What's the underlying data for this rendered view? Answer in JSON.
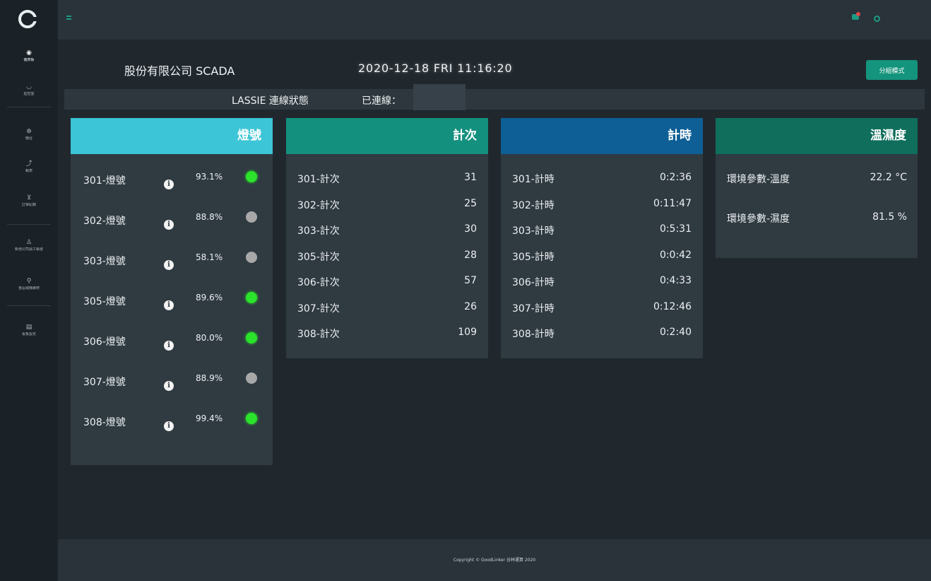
{
  "sidebar": {
    "items": [
      {
        "icon": "dashboard-icon",
        "label": "儀表板",
        "active": true
      },
      {
        "icon": "monitor-icon",
        "label": "監控室",
        "active": false
      },
      {
        "icon": "machine-icon",
        "label": "機台",
        "active": false
      },
      {
        "icon": "report-icon",
        "label": "報表",
        "active": false
      },
      {
        "icon": "cart-icon",
        "label": "訂單紀錄",
        "active": false
      },
      {
        "icon": "user-add-icon",
        "label": "新增公司員工帳號",
        "active": false
      },
      {
        "icon": "wrench-icon",
        "label": "各區域機維修",
        "active": false
      },
      {
        "icon": "board-icon",
        "label": "看板設定",
        "active": false
      }
    ]
  },
  "header": {
    "company": "股份有限公司 SCADA",
    "datetime": "2020-12-18 FRI 11:16:20",
    "mode_button": "分組模式",
    "connection_label": "LASSIE 連線狀態",
    "connection_status": "已連線："
  },
  "lights": {
    "title": "燈號",
    "color": "#3cc5d6",
    "rows": [
      {
        "name": "301-燈號",
        "pct": "93.1%",
        "on": true
      },
      {
        "name": "302-燈號",
        "pct": "88.8%",
        "on": false
      },
      {
        "name": "303-燈號",
        "pct": "58.1%",
        "on": false
      },
      {
        "name": "305-燈號",
        "pct": "89.6%",
        "on": true
      },
      {
        "name": "306-燈號",
        "pct": "80.0%",
        "on": true
      },
      {
        "name": "307-燈號",
        "pct": "88.9%",
        "on": false
      },
      {
        "name": "308-燈號",
        "pct": "99.4%",
        "on": true
      }
    ]
  },
  "counts": {
    "title": "計次",
    "color": "#14907e",
    "rows": [
      {
        "name": "301-計次",
        "value": "31"
      },
      {
        "name": "302-計次",
        "value": "25"
      },
      {
        "name": "303-計次",
        "value": "30"
      },
      {
        "name": "305-計次",
        "value": "28"
      },
      {
        "name": "306-計次",
        "value": "57"
      },
      {
        "name": "307-計次",
        "value": "26"
      },
      {
        "name": "308-計次",
        "value": "109"
      }
    ]
  },
  "timers": {
    "title": "計時",
    "color": "#0d5f96",
    "rows": [
      {
        "name": "301-計時",
        "value": "0:2:36"
      },
      {
        "name": "302-計時",
        "value": "0:11:47"
      },
      {
        "name": "303-計時",
        "value": "0:5:31"
      },
      {
        "name": "305-計時",
        "value": "0:0:42"
      },
      {
        "name": "306-計時",
        "value": "0:4:33"
      },
      {
        "name": "307-計時",
        "value": "0:12:46"
      },
      {
        "name": "308-計時",
        "value": "0:2:40"
      }
    ]
  },
  "env": {
    "title": "溫濕度",
    "color": "#0f6e5c",
    "rows": [
      {
        "name": "環境參數-溫度",
        "value": "22.2 °C"
      },
      {
        "name": "環境參數-濕度",
        "value": "81.5 %"
      }
    ]
  },
  "footer": {
    "copyright": "Copyright © GoodLinker 谷林運算 2020"
  },
  "colors": {
    "accent": "#14947c",
    "light_on": "#2be32b",
    "light_off": "#a8a8a8"
  }
}
